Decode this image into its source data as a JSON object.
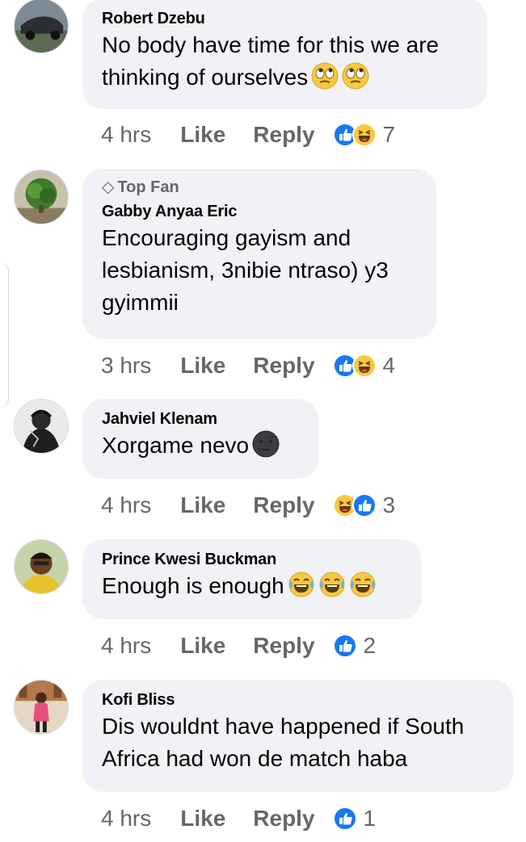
{
  "comments": [
    {
      "author": "Robert Dzebu",
      "text": "No body have time for this we are thinking of ourselves",
      "emojis": [
        "face-with-rolling-eyes-icon",
        "face-with-rolling-eyes-icon"
      ],
      "time": "4 hrs",
      "like_label": "Like",
      "reply_label": "Reply",
      "reactions": [
        "like-reaction-icon",
        "haha-reaction-icon"
      ],
      "reaction_count": "7"
    },
    {
      "badge": "Top Fan",
      "author": "Gabby Anyaa Eric",
      "text": "Encouraging gayism and lesbianism, 3nibie ntraso) y3 gyimmii",
      "time": "3 hrs",
      "like_label": "Like",
      "reply_label": "Reply",
      "reactions": [
        "like-reaction-icon",
        "haha-reaction-icon"
      ],
      "reaction_count": "4"
    },
    {
      "author": "Jahviel Klenam",
      "text": "Xorgame nevo",
      "emojis": [
        "new-moon-face-icon"
      ],
      "time": "4 hrs",
      "like_label": "Like",
      "reply_label": "Reply",
      "reactions": [
        "haha-reaction-icon",
        "like-reaction-icon"
      ],
      "reaction_count": "3"
    },
    {
      "author": "Prince Kwesi Buckman",
      "text": "Enough is enough",
      "emojis": [
        "tears-of-joy-icon",
        "tears-of-joy-icon",
        "tears-of-joy-icon"
      ],
      "time": "4 hrs",
      "like_label": "Like",
      "reply_label": "Reply",
      "reactions": [
        "like-reaction-icon"
      ],
      "reaction_count": "2"
    },
    {
      "author": "Kofi Bliss",
      "text": "Dis wouldnt have happened if South Africa had won de match haba",
      "time": "4 hrs",
      "like_label": "Like",
      "reply_label": "Reply",
      "reactions": [
        "like-reaction-icon"
      ],
      "reaction_count": "1"
    }
  ],
  "colors": {
    "bubble": "#f0f2f5",
    "meta_text": "#65676b",
    "like_blue": "#1877f2",
    "haha_yellow": "#f7c843"
  }
}
